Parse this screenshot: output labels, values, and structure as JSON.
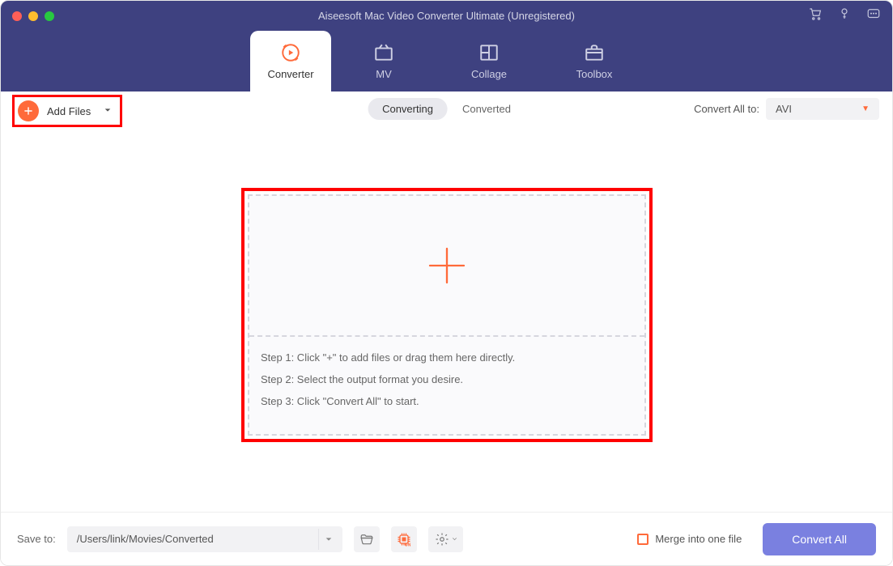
{
  "window": {
    "title": "Aiseesoft Mac Video Converter Ultimate (Unregistered)"
  },
  "tabs": [
    {
      "label": "Converter"
    },
    {
      "label": "MV"
    },
    {
      "label": "Collage"
    },
    {
      "label": "Toolbox"
    }
  ],
  "toolbar": {
    "add_files_label": "Add Files",
    "seg_converting": "Converting",
    "seg_converted": "Converted",
    "convert_all_to_label": "Convert All to:",
    "format_selected": "AVI"
  },
  "dropzone": {
    "step1": "Step 1: Click \"+\" to add files or drag them here directly.",
    "step2": "Step 2: Select the output format you desire.",
    "step3": "Step 3: Click \"Convert All\" to start."
  },
  "footer": {
    "save_to_label": "Save to:",
    "save_path": "/Users/link/Movies/Converted",
    "merge_label": "Merge into one file",
    "convert_all_button": "Convert All"
  }
}
